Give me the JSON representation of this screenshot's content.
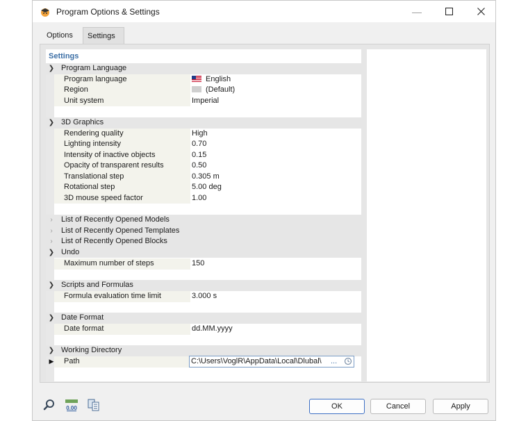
{
  "window": {
    "title": "Program Options & Settings"
  },
  "tabs": [
    {
      "label": "Options"
    },
    {
      "label": "Settings"
    }
  ],
  "tree": {
    "header": "Settings",
    "groups": {
      "program_language": {
        "label": "Program Language",
        "rows": [
          {
            "label": "Program language",
            "value": "English"
          },
          {
            "label": "Region",
            "value": "(Default)"
          },
          {
            "label": "Unit system",
            "value": "Imperial"
          }
        ]
      },
      "graphics": {
        "label": "3D Graphics",
        "rows": [
          {
            "label": "Rendering quality",
            "value": "High"
          },
          {
            "label": "Lighting intensity",
            "value": "0.70"
          },
          {
            "label": "Intensity of inactive objects",
            "value": "0.15"
          },
          {
            "label": "Opacity of transparent results",
            "value": "0.50"
          },
          {
            "label": "Translational step",
            "value": "0.305 m"
          },
          {
            "label": "Rotational step",
            "value": "5.00 deg"
          },
          {
            "label": "3D mouse speed factor",
            "value": "1.00"
          }
        ]
      },
      "recent_models": {
        "label": "List of Recently Opened Models"
      },
      "recent_templates": {
        "label": "List of Recently Opened Templates"
      },
      "recent_blocks": {
        "label": "List of Recently Opened Blocks"
      },
      "undo": {
        "label": "Undo",
        "rows": [
          {
            "label": "Maximum number of steps",
            "value": "150"
          }
        ]
      },
      "scripts": {
        "label": "Scripts and Formulas",
        "rows": [
          {
            "label": "Formula evaluation time limit",
            "value": "3.000 s"
          }
        ]
      },
      "date_format": {
        "label": "Date Format",
        "rows": [
          {
            "label": "Date format",
            "value": "dd.MM.yyyy"
          }
        ]
      },
      "working_directory": {
        "label": "Working Directory",
        "rows": [
          {
            "label": "Path",
            "value": "C:\\Users\\VoglR\\AppData\\Local\\Dlubal\\",
            "button": "..."
          }
        ]
      }
    }
  },
  "buttons": {
    "ok": "OK",
    "cancel": "Cancel",
    "apply": "Apply"
  },
  "icons": {
    "app": "graduation-cap-icon",
    "help": "help-search-icon",
    "units": "units-decimal-icon",
    "copy": "copy-settings-icon"
  }
}
